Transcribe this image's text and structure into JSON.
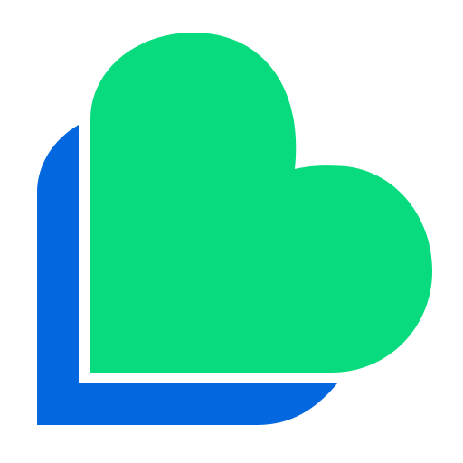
{
  "logo": {
    "icon": "heart-logo-icon",
    "colors": {
      "back_shape": "#0367E0",
      "front_shape": "#08DB7E",
      "gap": "#FFFFFF",
      "background": "#FFFFFF"
    }
  }
}
